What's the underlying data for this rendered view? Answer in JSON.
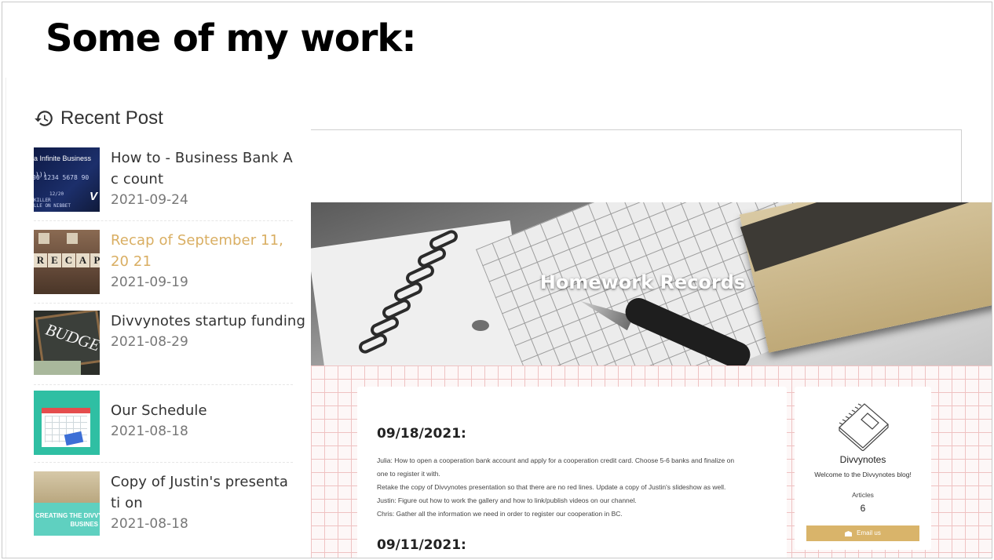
{
  "slide": {
    "title": "Some of my work:"
  },
  "recent": {
    "heading": "Recent Post",
    "posts": [
      {
        "title": "How to - Business Bank Ac count",
        "date": "2021-09-24",
        "thumb": "credit-card",
        "active": false
      },
      {
        "title": "Recap of September 11, 20 21",
        "date": "2021-09-19",
        "thumb": "recap-tiles",
        "active": true
      },
      {
        "title": "Divvynotes startup funding",
        "date": "2021-08-29",
        "thumb": "budget-board",
        "active": false
      },
      {
        "title": "Our Schedule",
        "date": "2021-08-18",
        "thumb": "schedule-calendar",
        "active": false
      },
      {
        "title": "Copy of Justin's presentati on",
        "date": "2021-08-18",
        "thumb": "creating-divvy",
        "active": false
      }
    ],
    "thumb_text": {
      "card_brand": "a Infinite Business",
      "card_number": "00 1234 5678 90",
      "card_expiry": "12/20",
      "card_name": "KILLER\nLLE ON NIBBET",
      "card_logo": "V",
      "recap_letters": [
        "R",
        "E",
        "C",
        "A",
        "P"
      ],
      "budget_word": "BUDGE",
      "copy_caption_1": "CREATING THE DIVVY",
      "copy_caption_2": "BUSINES"
    }
  },
  "blog": {
    "hero_title": "Homework Records",
    "entries": [
      {
        "date": "09/18/2021:",
        "lines": [
          "Julia: How to open a cooperation bank account and apply for a cooperation credit card. Choose 5-6 banks and finalize on",
          "one to register it with.",
          "Retake the copy of Divvynotes presentation so that there are no red lines. Update a copy of Justin's slideshow as well.",
          "Justin: Figure out how to work the gallery and how to link/publish videos on our channel.",
          "Chris: Gather all the information we need in order to register our cooperation in BC."
        ]
      },
      {
        "date": "09/11/2021:",
        "lines": []
      }
    ],
    "profile": {
      "name": "Divvynotes",
      "description": "Welcome to the Divvynotes blog!",
      "articles_label": "Articles",
      "articles_count": "6",
      "email_button": "Email us"
    },
    "colors": {
      "accent": "#d9b46a",
      "active_post": "#d9ae62",
      "grid_line": "#efc2c2"
    }
  }
}
